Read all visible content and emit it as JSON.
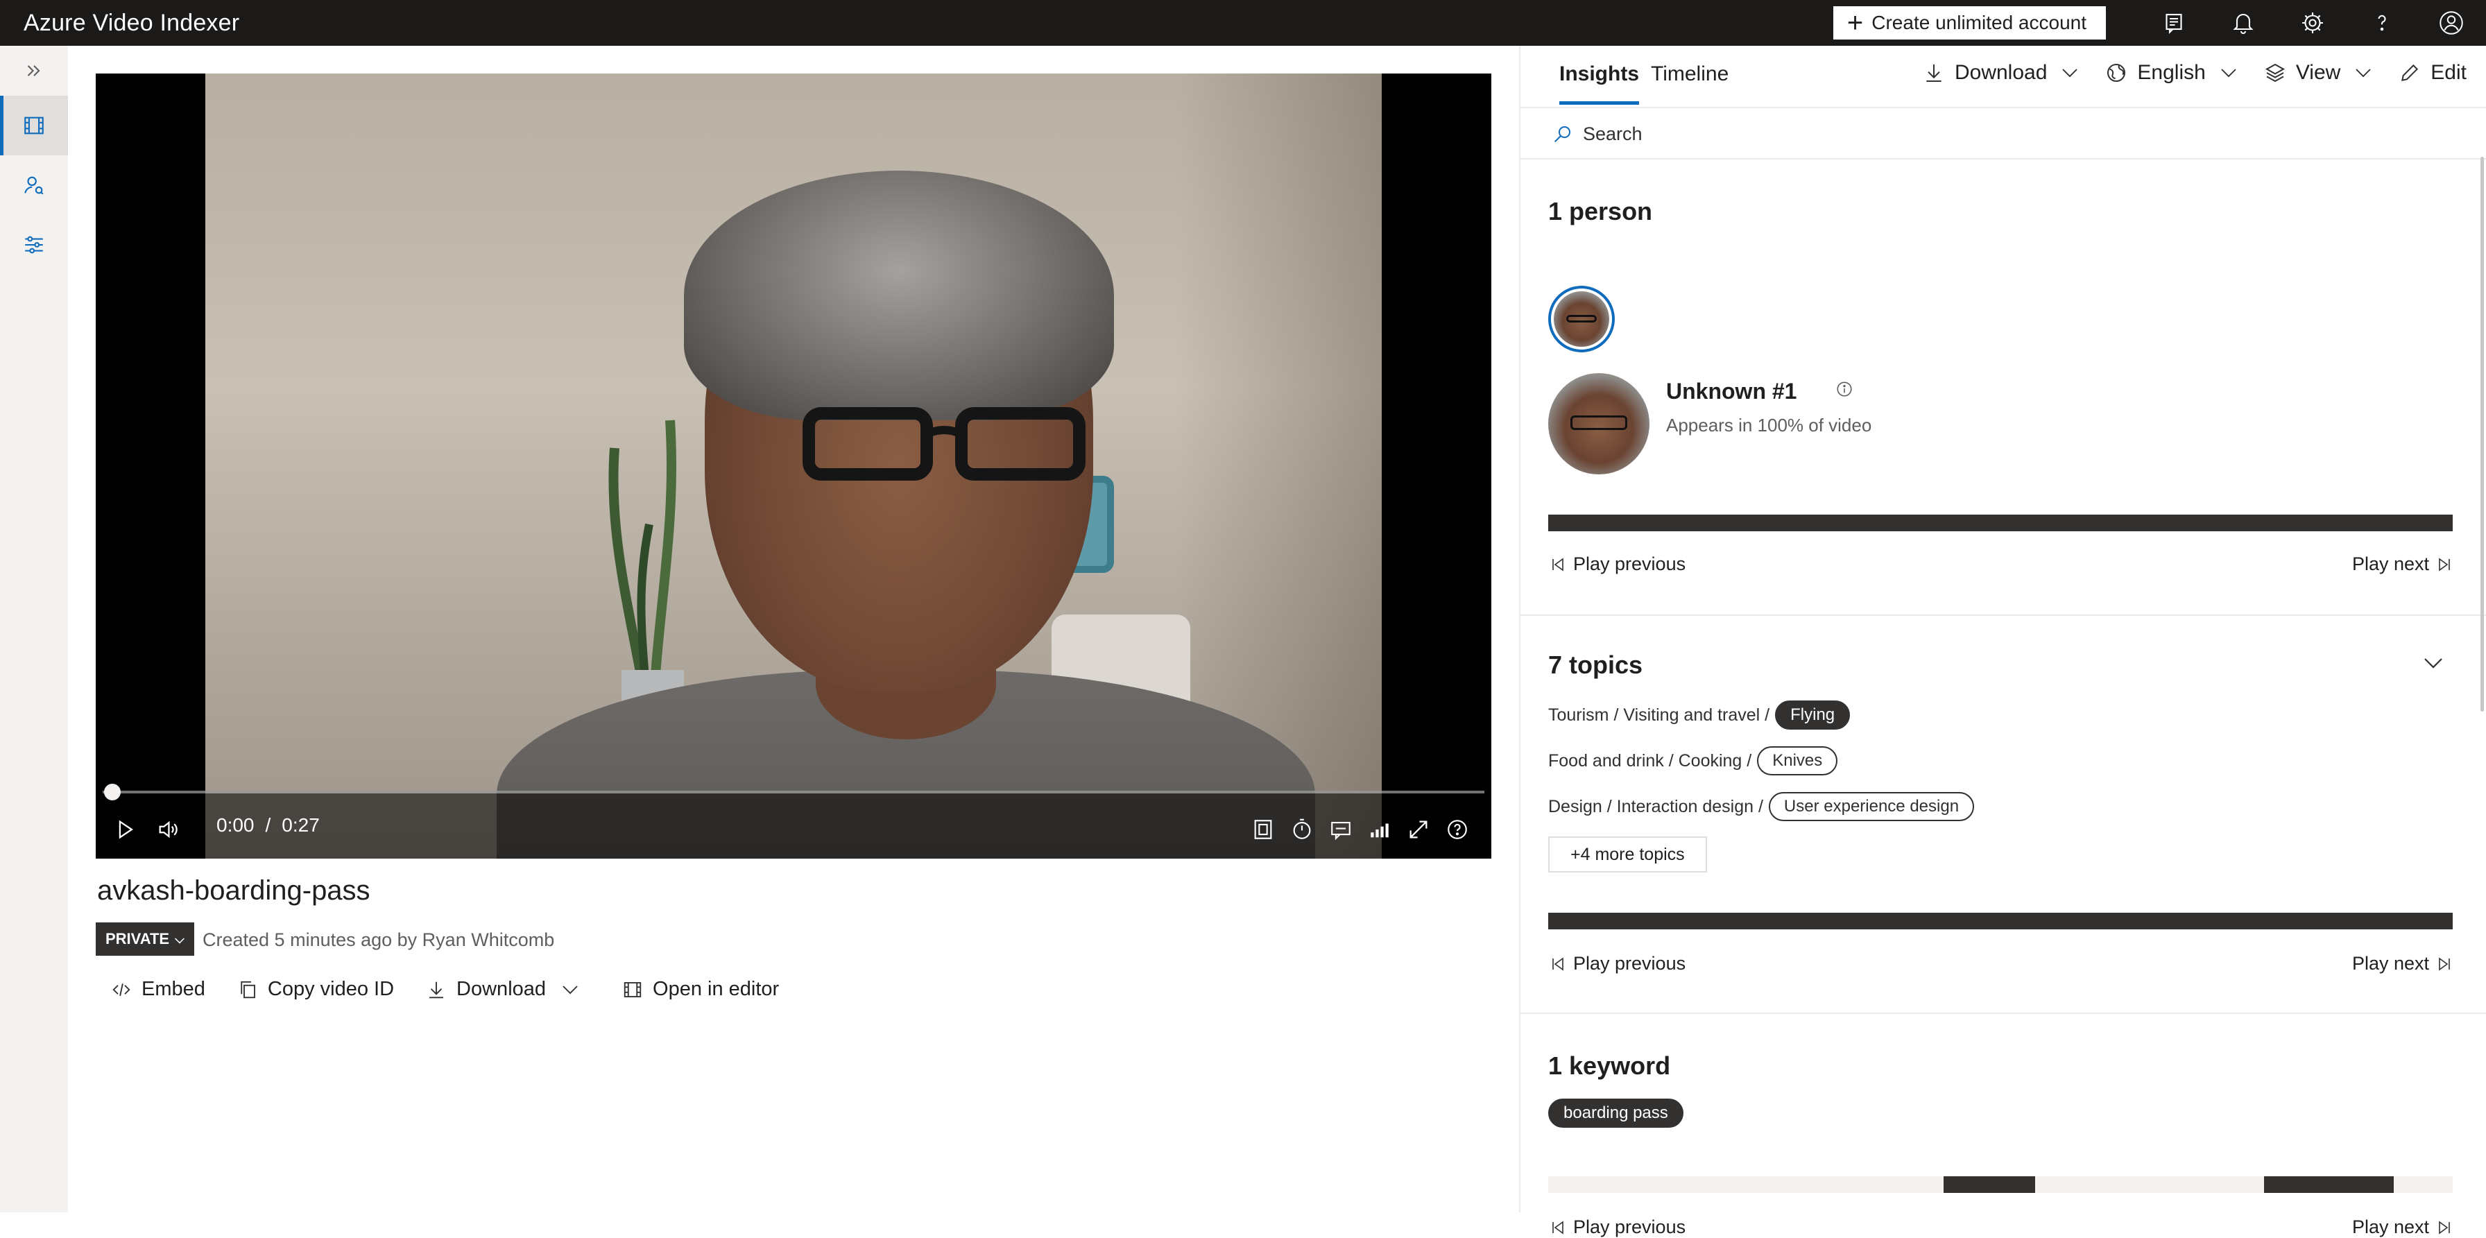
{
  "app": {
    "title": "Azure Video Indexer",
    "create_account_label": "Create unlimited account"
  },
  "topbar_icons": [
    "feedback-icon",
    "bell-icon",
    "gear-icon",
    "help-icon",
    "user-icon"
  ],
  "rail": [
    "video-library-icon",
    "people-icon",
    "settings-sliders-icon"
  ],
  "player": {
    "current_time": "0:00",
    "separator": "/",
    "duration": "0:27",
    "progress": 0
  },
  "video": {
    "title": "avkash-boarding-pass",
    "visibility": "PRIVATE",
    "created": "Created 5 minutes ago by Ryan Whitcomb"
  },
  "actions": {
    "embed": "Embed",
    "copy_id": "Copy video ID",
    "download": "Download",
    "open_editor": "Open in editor"
  },
  "panel": {
    "tabs": [
      "Insights",
      "Timeline"
    ],
    "active_tab": "Insights",
    "download": "Download",
    "language": "English",
    "view": "View",
    "edit": "Edit",
    "search_placeholder": "Search"
  },
  "people": {
    "title": "1 person",
    "name": "Unknown #1",
    "appears": "Appears in 100% of video",
    "coverage": 1.0
  },
  "topics": {
    "title": "7 topics",
    "rows": [
      {
        "path": "Tourism / Visiting and travel /",
        "tag": "Flying",
        "selected": true
      },
      {
        "path": "Food and drink / Cooking /",
        "tag": "Knives",
        "selected": false
      },
      {
        "path": "Design / Interaction design /",
        "tag": "User experience design",
        "selected": false
      }
    ],
    "more": "+4 more topics",
    "coverage": 1.0
  },
  "keywords": {
    "title": "1 keyword",
    "items": [
      "boarding pass"
    ],
    "segments": [
      [
        0.4368,
        0.5386
      ],
      [
        0.7913,
        0.9349
      ]
    ]
  },
  "nav": {
    "play_previous": "Play previous",
    "play_next": "Play next"
  },
  "colors": {
    "topbar": "#1b1a19",
    "accent": "#0f6cbd",
    "dark_fill": "#323130"
  }
}
